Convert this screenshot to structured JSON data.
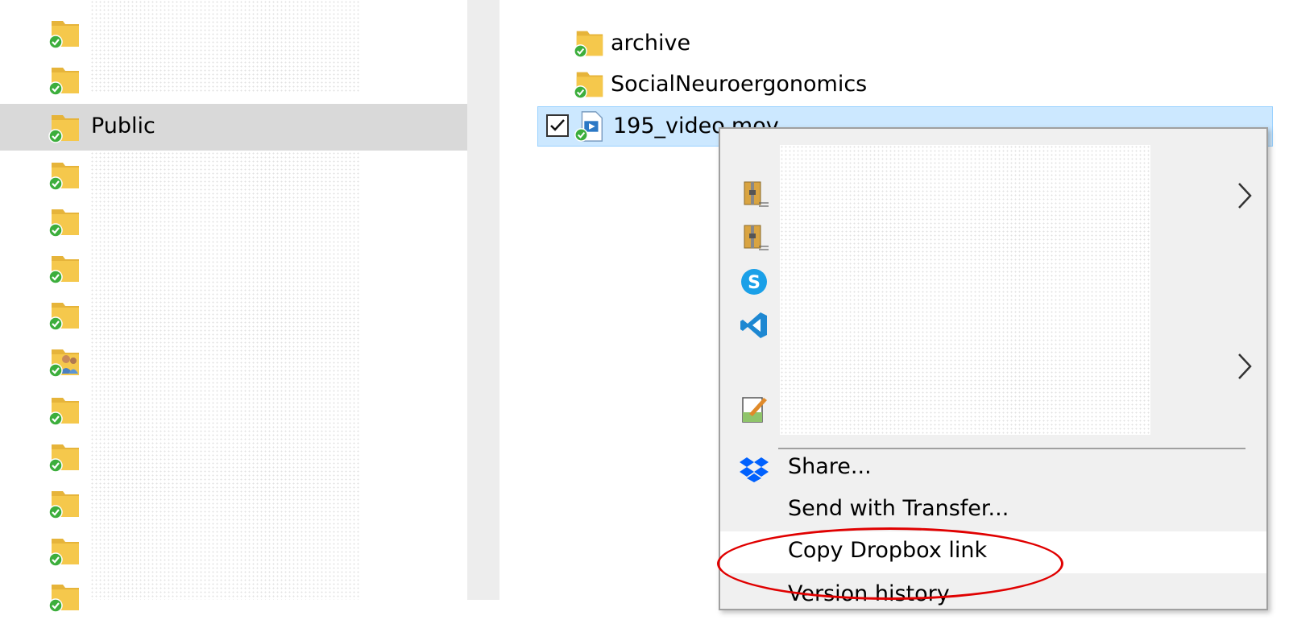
{
  "nav_pane": {
    "selected_label": "Public",
    "row_count_visible": 13
  },
  "content_pane": {
    "files": [
      {
        "name": "archive",
        "icon": "folder-synced-icon"
      },
      {
        "name": "SocialNeuroergonomics",
        "icon": "folder-synced-icon"
      },
      {
        "name": "195_video.mov",
        "icon": "video-file-synced-icon",
        "selected": true
      }
    ]
  },
  "context_menu": {
    "items": [
      {
        "label": "Share...",
        "icon": "dropbox-icon"
      },
      {
        "label": "Send with Transfer..."
      },
      {
        "label": "Copy Dropbox link",
        "highlighted": true
      },
      {
        "label": "Version history"
      }
    ],
    "icons_in_redacted_area": [
      "archive-zip-icon",
      "archive-zip-icon",
      "skype-icon",
      "vscode-icon",
      "notepad-edit-icon"
    ]
  },
  "colors": {
    "selection_bg": "#cce8ff",
    "nav_selected_bg": "#d9d9d9",
    "highlight_red": "#e00000",
    "folder_yellow": "#f5c84c",
    "sync_green": "#3cae3c"
  }
}
